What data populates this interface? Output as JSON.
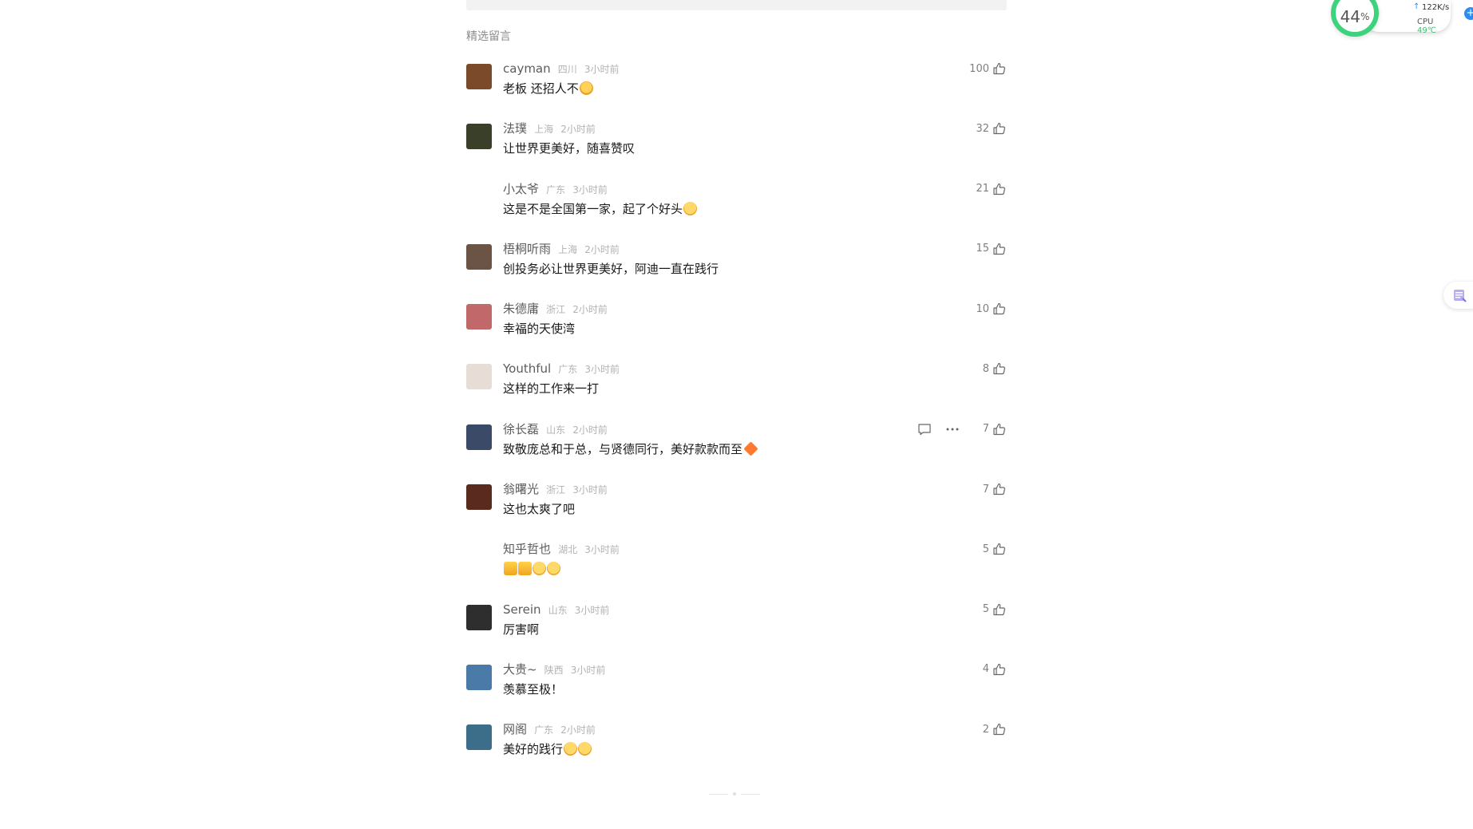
{
  "section_title": "精选留言",
  "comments": [
    {
      "nickname": "cayman",
      "region": "四川",
      "time": "3小时前",
      "content": "老板 还招人不",
      "emoji": "star",
      "likes": "100",
      "avatar_color": "#7b4a2a"
    },
    {
      "nickname": "法璞",
      "region": "上海",
      "time": "2小时前",
      "content": "让世界更美好，随喜赞叹",
      "emoji": "",
      "likes": "32",
      "avatar_color": "#3a3f2a"
    },
    {
      "nickname": "小太爷",
      "region": "广东",
      "time": "3小时前",
      "content": "这是不是全国第一家，起了个好头",
      "emoji": "smile",
      "likes": "21",
      "avatar_color": ""
    },
    {
      "nickname": "梧桐听雨",
      "region": "上海",
      "time": "2小时前",
      "content": "创投务必让世界更美好，阿迪一直在践行",
      "emoji": "",
      "likes": "15",
      "avatar_color": "#6b5446"
    },
    {
      "nickname": "朱德庸",
      "region": "浙江",
      "time": "2小时前",
      "content": "幸福的天使湾",
      "emoji": "",
      "likes": "10",
      "avatar_color": "#c0686a"
    },
    {
      "nickname": "Youthful",
      "region": "广东",
      "time": "3小时前",
      "content": "这样的工作来一打",
      "emoji": "",
      "likes": "8",
      "avatar_color": "#e8dcd6"
    },
    {
      "nickname": "徐长磊",
      "region": "山东",
      "time": "2小时前",
      "content": "致敬庞总和于总，与贤德同行，美好款款而至",
      "emoji": "diamond",
      "likes": "7",
      "avatar_color": "#3b4a66",
      "show_actions": true
    },
    {
      "nickname": "翁曙光",
      "region": "浙江",
      "time": "3小时前",
      "content": "这也太爽了吧",
      "emoji": "",
      "likes": "7",
      "avatar_color": "#5a2a1e"
    },
    {
      "nickname": "知乎哲也",
      "region": "湖北",
      "time": "3小时前",
      "content": "",
      "emoji": "thumbs",
      "likes": "5",
      "avatar_color": "#ffffff"
    },
    {
      "nickname": "Serein",
      "region": "山东",
      "time": "3小时前",
      "content": "厉害啊",
      "emoji": "",
      "likes": "5",
      "avatar_color": "#2e2e2e"
    },
    {
      "nickname": "大贵~",
      "region": "陕西",
      "time": "3小时前",
      "content": "羡慕至极！",
      "emoji": "",
      "likes": "4",
      "avatar_color": "#4a7aa8"
    },
    {
      "nickname": "网阁",
      "region": "广东",
      "time": "2小时前",
      "content": "美好的践行",
      "emoji": "grin2",
      "likes": "2",
      "avatar_color": "#3c6e8a"
    }
  ],
  "monitor": {
    "percent": "44",
    "percent_unit": "%",
    "net_speed": "122K/s",
    "cpu_label": "CPU",
    "cpu_temp": "49℃",
    "ring_color": "#3fd27c"
  }
}
